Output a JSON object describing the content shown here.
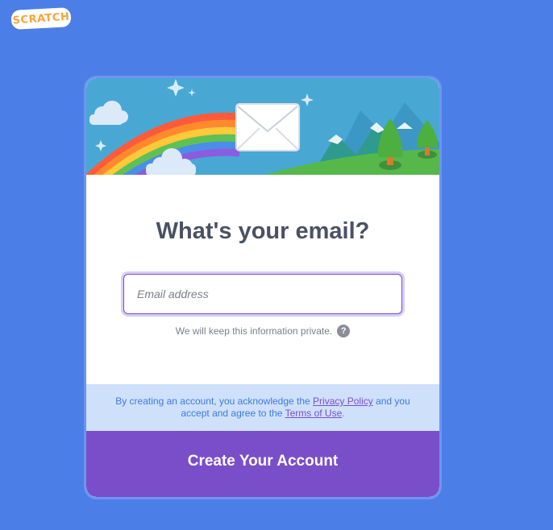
{
  "brand": {
    "logo_text": "SCRATCH"
  },
  "colors": {
    "page_background": "#4c7ee8",
    "title_text": "#4a5164",
    "legal_background": "#cfe0fa",
    "legal_text": "#3b7be3",
    "link": "#7a4fcf",
    "primary_button": "#7a4ec8",
    "logo_orange": "#f9a437"
  },
  "banner": {
    "illustration": "rainbow-envelope-mountains-illustration"
  },
  "form": {
    "title": "What's your email?",
    "email": {
      "value": "",
      "placeholder": "Email address"
    },
    "privacy_note": "We will keep this information private.",
    "help_icon": "?"
  },
  "legal": {
    "text_before": "By creating an account, you acknowledge the ",
    "privacy_link": "Privacy Policy",
    "text_middle": " and you accept and agree to the ",
    "terms_link": "Terms of Use",
    "text_after": "."
  },
  "actions": {
    "create_label": "Create Your Account"
  }
}
